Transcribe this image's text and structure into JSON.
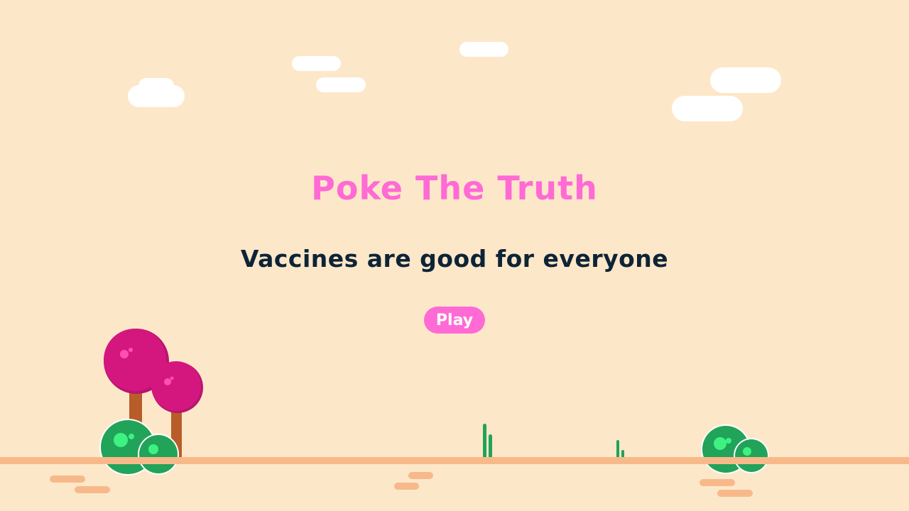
{
  "game": {
    "title": "Poke The Truth",
    "subtitle": "Vaccines are good for everyone",
    "play_label": "Play"
  },
  "colors": {
    "background": "#fde7c9",
    "title": "#ff6ad5",
    "subtitle": "#0d2436",
    "button": "#ff6ad5",
    "ground": "#f8b98a",
    "tree_canopy": "#d4177f",
    "tree_trunk": "#b85c2a",
    "bush": "#21a35a",
    "bush_spot": "#3ef282",
    "cloud": "#ffffff"
  },
  "decor": {
    "clouds": "cloud-icon",
    "trees": "tree-icon",
    "bushes": "bush-icon",
    "grass": "grass-icon"
  }
}
